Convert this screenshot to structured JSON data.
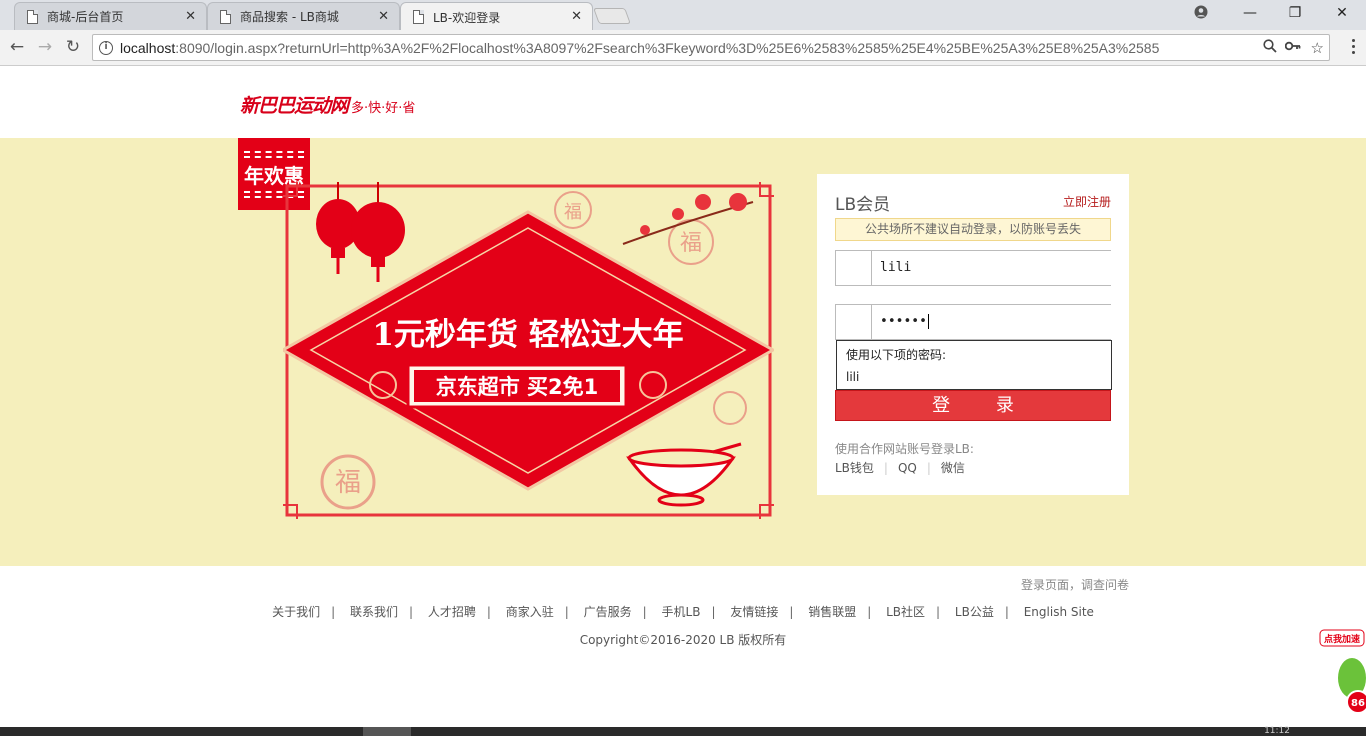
{
  "browser": {
    "tabs": [
      {
        "title": "商城-后台首页",
        "active": false
      },
      {
        "title": "商品搜索 - LB商城",
        "active": false
      },
      {
        "title": "LB-欢迎登录",
        "active": true
      }
    ],
    "address": {
      "host": "localhost",
      "rest": ":8090/login.aspx?returnUrl=http%3A%2F%2Flocalhost%3A8097%2Fsearch%3Fkeyword%3D%25E6%2583%2585%25E4%25BE%25A3%25E8%25A3%2585"
    },
    "icons": [
      "back-icon",
      "forward-icon",
      "reload-icon",
      "info-icon",
      "zoom-icon",
      "key-icon",
      "star-icon",
      "menu-icon",
      "account-icon",
      "minimize-icon",
      "restore-icon",
      "close-icon"
    ]
  },
  "header": {
    "logo_text": "新巴巴运动网",
    "slogan": "多·快·好·省"
  },
  "banner": {
    "badge": "年欢惠",
    "headline": "1元秒年货 轻松过大年",
    "subline": "京东超市 买2免1",
    "colors": {
      "band": "#f5efbc",
      "red": "#e30017"
    }
  },
  "login": {
    "title": "LB会员",
    "register_link": "立即注册",
    "tip": "公共场所不建议自动登录，以防账号丢失",
    "username": "lili",
    "password_mask": "••••••",
    "autofill_header": "使用以下项的密码:",
    "autofill_suggestion": "lili",
    "button": "登 录",
    "partner_label": "使用合作网站账号登录LB:",
    "partners": [
      "LB钱包",
      "QQ",
      "微信"
    ],
    "colors": {
      "button": "#e4393c",
      "link": "#b61d1d"
    }
  },
  "footer": {
    "survey": "登录页面，调查问卷",
    "links": [
      "关于我们",
      "联系我们",
      "人才招聘",
      "商家入驻",
      "广告服务",
      "手机LB",
      "友情链接",
      "销售联盟",
      "LB社区",
      "LB公益",
      "English Site"
    ],
    "copyright": "Copyright©2016-2020  LB 版权所有"
  },
  "floating": {
    "label": "点我加速",
    "count": "86"
  },
  "taskbar": {
    "time": "11:12"
  }
}
